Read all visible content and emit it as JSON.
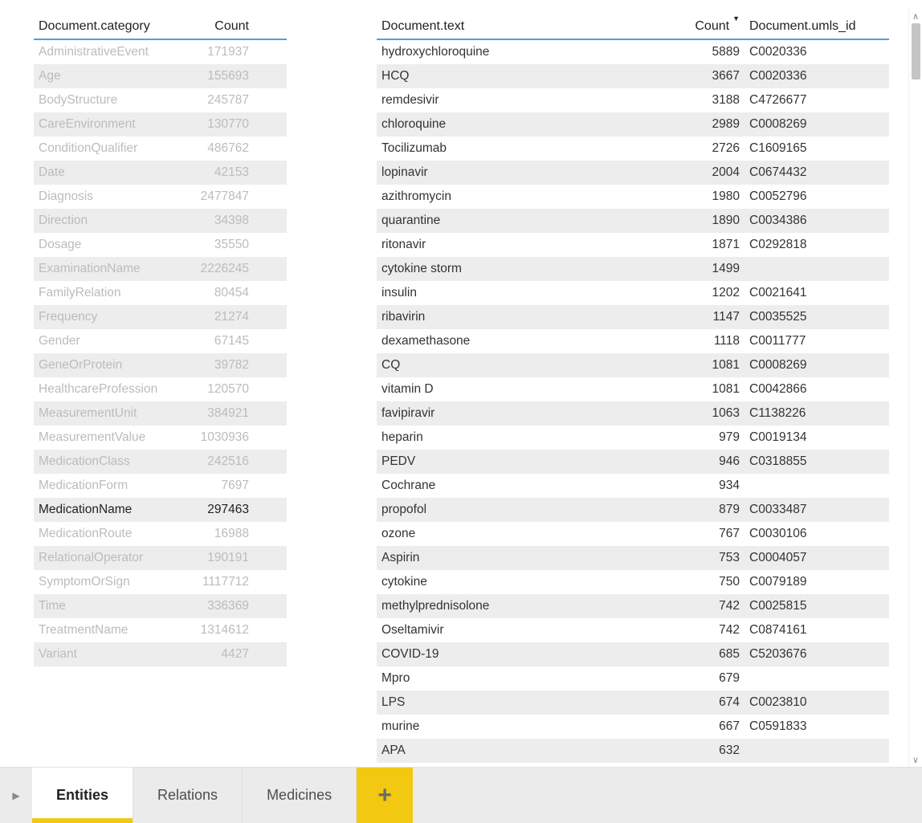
{
  "left_table": {
    "columns": {
      "category": "Document.category",
      "count": "Count"
    },
    "selected_index": 20,
    "rows": [
      {
        "category": "AdministrativeEvent",
        "count": "171937"
      },
      {
        "category": "Age",
        "count": "155693"
      },
      {
        "category": "BodyStructure",
        "count": "245787"
      },
      {
        "category": "CareEnvironment",
        "count": "130770"
      },
      {
        "category": "ConditionQualifier",
        "count": "486762"
      },
      {
        "category": "Date",
        "count": "42153"
      },
      {
        "category": "Diagnosis",
        "count": "2477847"
      },
      {
        "category": "Direction",
        "count": "34398"
      },
      {
        "category": "Dosage",
        "count": "35550"
      },
      {
        "category": "ExaminationName",
        "count": "2226245"
      },
      {
        "category": "FamilyRelation",
        "count": "80454"
      },
      {
        "category": "Frequency",
        "count": "21274"
      },
      {
        "category": "Gender",
        "count": "67145"
      },
      {
        "category": "GeneOrProtein",
        "count": "39782"
      },
      {
        "category": "HealthcareProfession",
        "count": "120570"
      },
      {
        "category": "MeasurementUnit",
        "count": "384921"
      },
      {
        "category": "MeasurementValue",
        "count": "1030936"
      },
      {
        "category": "MedicationClass",
        "count": "242516"
      },
      {
        "category": "MedicationForm",
        "count": "7697"
      },
      {
        "category": "MedicationName",
        "count": "297463"
      },
      {
        "category": "MedicationRoute",
        "count": "16988"
      },
      {
        "category": "RelationalOperator",
        "count": "190191"
      },
      {
        "category": "SymptomOrSign",
        "count": "1117712"
      },
      {
        "category": "Time",
        "count": "336369"
      },
      {
        "category": "TreatmentName",
        "count": "1314612"
      },
      {
        "category": "Variant",
        "count": "4427"
      }
    ]
  },
  "right_table": {
    "columns": {
      "text": "Document.text",
      "count": "Count",
      "umls": "Document.umls_id"
    },
    "sort_column": "count",
    "sort_direction": "desc",
    "rows": [
      {
        "text": "hydroxychloroquine",
        "count": "5889",
        "umls": "C0020336"
      },
      {
        "text": "HCQ",
        "count": "3667",
        "umls": "C0020336"
      },
      {
        "text": "remdesivir",
        "count": "3188",
        "umls": "C4726677"
      },
      {
        "text": "chloroquine",
        "count": "2989",
        "umls": "C0008269"
      },
      {
        "text": "Tocilizumab",
        "count": "2726",
        "umls": "C1609165"
      },
      {
        "text": "lopinavir",
        "count": "2004",
        "umls": "C0674432"
      },
      {
        "text": "azithromycin",
        "count": "1980",
        "umls": "C0052796"
      },
      {
        "text": "quarantine",
        "count": "1890",
        "umls": "C0034386"
      },
      {
        "text": "ritonavir",
        "count": "1871",
        "umls": "C0292818"
      },
      {
        "text": "cytokine storm",
        "count": "1499",
        "umls": ""
      },
      {
        "text": "insulin",
        "count": "1202",
        "umls": "C0021641"
      },
      {
        "text": "ribavirin",
        "count": "1147",
        "umls": "C0035525"
      },
      {
        "text": "dexamethasone",
        "count": "1118",
        "umls": "C0011777"
      },
      {
        "text": "CQ",
        "count": "1081",
        "umls": "C0008269"
      },
      {
        "text": "vitamin D",
        "count": "1081",
        "umls": "C0042866"
      },
      {
        "text": "favipiravir",
        "count": "1063",
        "umls": "C1138226"
      },
      {
        "text": "heparin",
        "count": "979",
        "umls": "C0019134"
      },
      {
        "text": "PEDV",
        "count": "946",
        "umls": "C0318855"
      },
      {
        "text": "Cochrane",
        "count": "934",
        "umls": ""
      },
      {
        "text": "propofol",
        "count": "879",
        "umls": "C0033487"
      },
      {
        "text": "ozone",
        "count": "767",
        "umls": "C0030106"
      },
      {
        "text": "Aspirin",
        "count": "753",
        "umls": "C0004057"
      },
      {
        "text": "cytokine",
        "count": "750",
        "umls": "C0079189"
      },
      {
        "text": "methylprednisolone",
        "count": "742",
        "umls": "C0025815"
      },
      {
        "text": "Oseltamivir",
        "count": "742",
        "umls": "C0874161"
      },
      {
        "text": "COVID-19",
        "count": "685",
        "umls": "C5203676"
      },
      {
        "text": "Mpro",
        "count": "679",
        "umls": ""
      },
      {
        "text": "LPS",
        "count": "674",
        "umls": "C0023810"
      },
      {
        "text": "murine",
        "count": "667",
        "umls": "C0591833"
      },
      {
        "text": "APA",
        "count": "632",
        "umls": ""
      }
    ]
  },
  "tabs": {
    "items": [
      {
        "label": "Entities"
      },
      {
        "label": "Relations"
      },
      {
        "label": "Medicines"
      }
    ],
    "active_index": 0,
    "add_label": "+"
  }
}
